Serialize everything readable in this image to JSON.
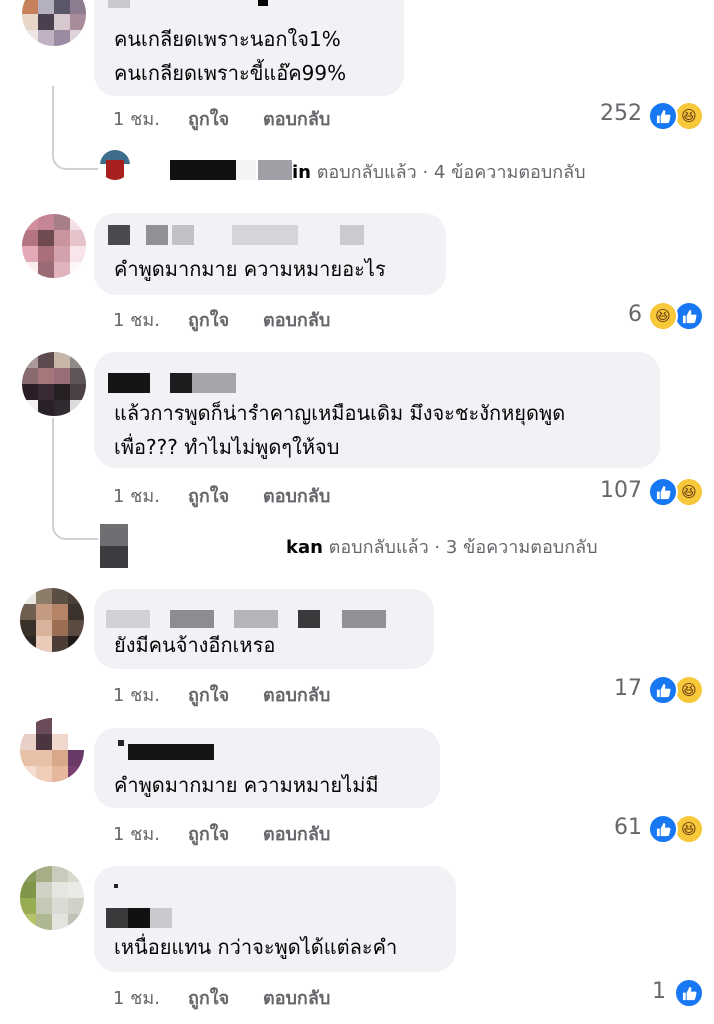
{
  "ui": {
    "time": "1 ชม.",
    "like": "ถูกใจ",
    "reply": "ตอบกลับ"
  },
  "colors": {
    "like_blue": "#1877f2",
    "haha_yellow": "#f7c93a",
    "bubble_bg": "#f0f2f5",
    "meta_gray": "#65676b"
  },
  "comments": [
    {
      "line1": "คนเกลียดเพราะนอกใจ1%",
      "line2": "คนเกลียดเพราะขี้แอ๊ค99%",
      "count": "252"
    },
    {
      "line1": "คำพูดมากมาย ความหมายอะไร",
      "count": "6"
    },
    {
      "line1": "แล้วการพูดก็น่ารำคาญเหมือนเดิม  มึงจะชะงักหยุดพูด",
      "line2": "เพื่อ??? ทำไมไม่พูดๆให้จบ",
      "count": "107"
    },
    {
      "line1": "ยังมีคนจ้างอีกเหรอ",
      "count": "17"
    },
    {
      "line1": "คำพูดมากมาย ความหมายไม่มี",
      "count": "61"
    },
    {
      "line1": "เหนื่อยแทน กว่าจะพูดได้แต่ละคำ",
      "count": "1"
    }
  ],
  "replies": [
    {
      "name_tail": "in",
      "text": "ตอบกลับแล้ว · 4 ข้อความตอบกลับ"
    },
    {
      "name_tail": "kan",
      "text": "ตอบกลับแล้ว · 3 ข้อความตอบกลับ"
    }
  ],
  "icons": {
    "like": "thumbs-up-icon",
    "haha": "laughing-face-icon"
  }
}
